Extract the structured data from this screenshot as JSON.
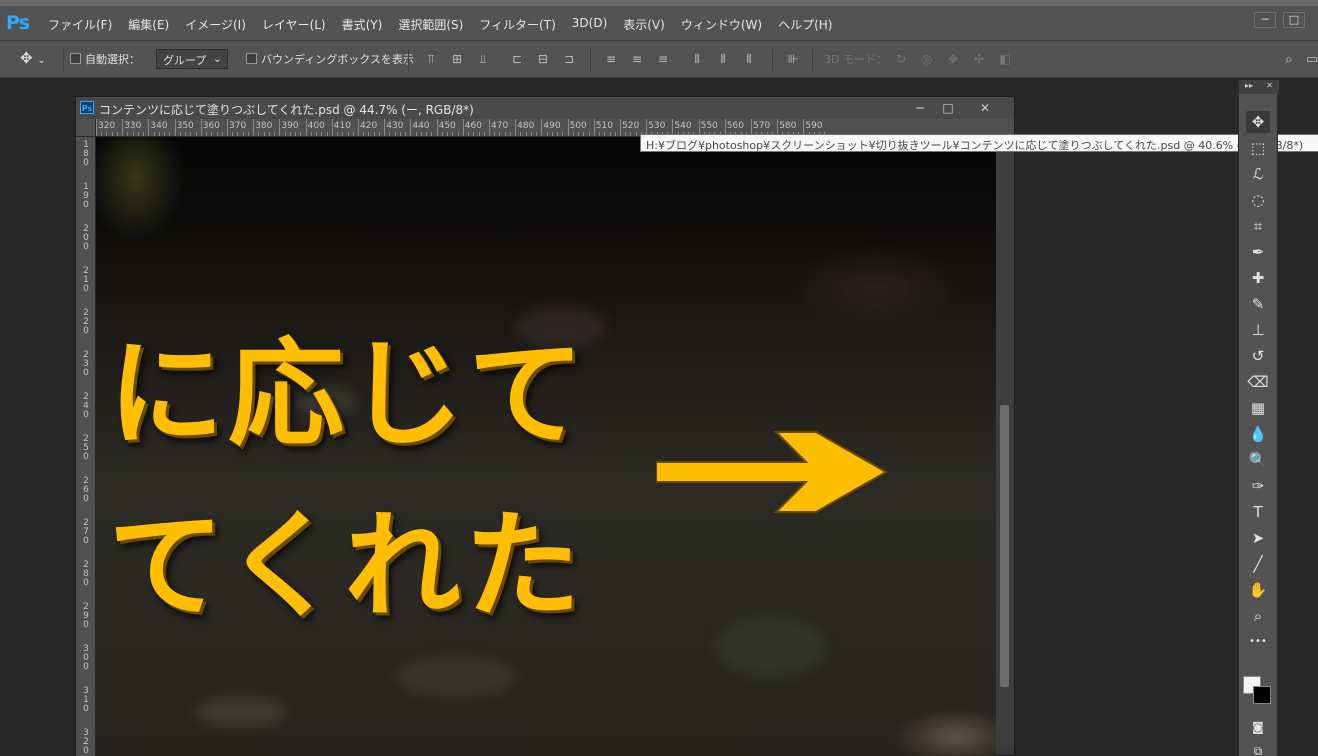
{
  "app": {
    "logo": "Ps"
  },
  "menu": [
    "ファイル(F)",
    "編集(E)",
    "イメージ(I)",
    "レイヤー(L)",
    "書式(Y)",
    "選択範囲(S)",
    "フィルター(T)",
    "3D(D)",
    "表示(V)",
    "ウィンドウ(W)",
    "ヘルプ(H)"
  ],
  "window_controls": {
    "minimize": "─",
    "restore": "□"
  },
  "options": {
    "auto_select_label": "自動選択：",
    "group_value": "グループ",
    "bounding_box_label": "バウンディングボックスを表示",
    "mode_3d_label": "3D モード："
  },
  "document": {
    "title": "コンテンツに応じて塗りつぶしてくれた.psd @ 44.7% (ー, RGB/8*)",
    "ps_icon": "Ps",
    "minimize": "─",
    "maximize": "□",
    "close": "✕",
    "ruler_h": [
      "320",
      "330",
      "340",
      "350",
      "360",
      "370",
      "380",
      "390",
      "400",
      "410",
      "420",
      "430",
      "440",
      "450",
      "460",
      "470",
      "480",
      "490",
      "500",
      "510",
      "520",
      "530",
      "540",
      "550",
      "560",
      "570",
      "580",
      "590"
    ],
    "ruler_v": [
      "180",
      "190",
      "200",
      "210",
      "220",
      "230",
      "240",
      "250",
      "260",
      "270",
      "280",
      "290",
      "300",
      "310",
      "320"
    ],
    "canvas_text": "に応じて\nてくれた",
    "canvas_arrow_color": "#ffbf00"
  },
  "tooltip": "H:¥ブログ¥photoshop¥スクリーンショット¥切り抜きツール¥コンテンツに応じて塗りつぶしてくれた.psd @ 40.6% (ー, RGB/8*)",
  "tools": [
    {
      "name": "move-tool-icon",
      "glyph": "✥"
    },
    {
      "name": "marquee-tool-icon",
      "glyph": "⬚"
    },
    {
      "name": "lasso-tool-icon",
      "glyph": "ℒ"
    },
    {
      "name": "quick-select-tool-icon",
      "glyph": "◌"
    },
    {
      "name": "crop-tool-icon",
      "glyph": "⌗"
    },
    {
      "name": "eyedropper-tool-icon",
      "glyph": "✒"
    },
    {
      "name": "healing-brush-tool-icon",
      "glyph": "✚"
    },
    {
      "name": "brush-tool-icon",
      "glyph": "✎"
    },
    {
      "name": "clone-stamp-tool-icon",
      "glyph": "⊥"
    },
    {
      "name": "history-brush-tool-icon",
      "glyph": "↺"
    },
    {
      "name": "eraser-tool-icon",
      "glyph": "⌫"
    },
    {
      "name": "gradient-tool-icon",
      "glyph": "▦"
    },
    {
      "name": "blur-tool-icon",
      "glyph": "💧"
    },
    {
      "name": "dodge-tool-icon",
      "glyph": "🔍"
    },
    {
      "name": "pen-tool-icon",
      "glyph": "✑"
    },
    {
      "name": "type-tool-icon",
      "glyph": "T"
    },
    {
      "name": "path-select-tool-icon",
      "glyph": "➤"
    },
    {
      "name": "line-tool-icon",
      "glyph": "╱"
    },
    {
      "name": "hand-tool-icon",
      "glyph": "✋"
    },
    {
      "name": "zoom-tool-icon",
      "glyph": "⌕"
    },
    {
      "name": "more-tools-icon",
      "glyph": "•••"
    }
  ],
  "colors": {
    "accent": "#31a8ff",
    "canvas_text": "#ffbf00"
  }
}
